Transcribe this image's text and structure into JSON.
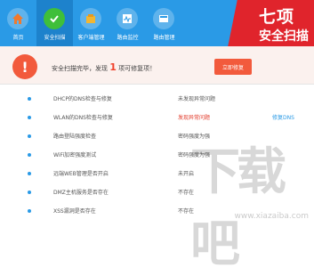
{
  "nav": {
    "items": [
      {
        "label": "首页",
        "icon": "home-icon"
      },
      {
        "label": "安全扫描",
        "icon": "shield-check-icon"
      },
      {
        "label": "客户端管理",
        "icon": "client-box-icon"
      },
      {
        "label": "路由监控",
        "icon": "monitor-icon"
      },
      {
        "label": "路由管理",
        "icon": "router-manage-icon"
      }
    ],
    "active_index": 1
  },
  "badge": {
    "line1": "七项",
    "line2": "安全扫描"
  },
  "alert": {
    "prefix": "安全扫描完毕，发现",
    "count": "1",
    "suffix": "项可修复项！",
    "button": "立即修复"
  },
  "items": [
    {
      "name": "DHCP的DNS检查与修复",
      "status": "未发现异常问题",
      "status_bad": false,
      "action": ""
    },
    {
      "name": "WLAN的DNS检查与修复",
      "status": "发现异常问题",
      "status_bad": true,
      "action": "修复DNS"
    },
    {
      "name": "路由登陆强度检查",
      "status": "密码强度为强",
      "status_bad": false,
      "action": ""
    },
    {
      "name": "WiFi加密强度测试",
      "status": "密码强度为强",
      "status_bad": false,
      "action": ""
    },
    {
      "name": "远端WEB管理是否开启",
      "status": "未开启",
      "status_bad": false,
      "action": ""
    },
    {
      "name": "DMZ主机服务是否存在",
      "status": "不存在",
      "status_bad": false,
      "action": ""
    },
    {
      "name": "XSS漏洞是否存在",
      "status": "不存在",
      "status_bad": false,
      "action": ""
    }
  ],
  "watermark": {
    "text": "下载吧",
    "url": "www.xiazaiba.com"
  },
  "colors": {
    "topbar": "#2a9ae6",
    "alert": "#f25a3c",
    "badge": "#e0242c"
  }
}
